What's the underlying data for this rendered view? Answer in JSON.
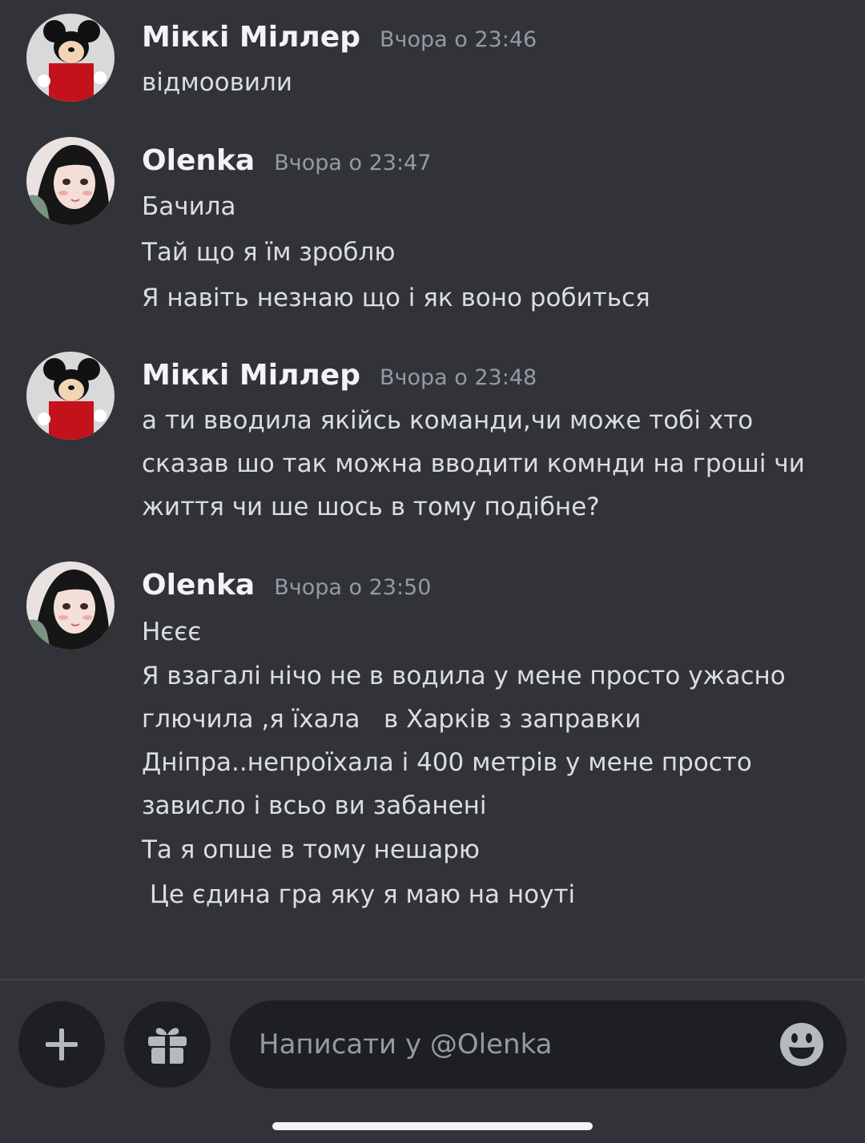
{
  "messages": [
    {
      "author": "Міккі Міллер",
      "timestamp": "Вчора о 23:46",
      "avatar_icon": "mickey-mouse-avatar",
      "lines": [
        "відмоовили"
      ]
    },
    {
      "author": "Olenka",
      "timestamp": "Вчора о 23:47",
      "avatar_icon": "anime-girl-avatar",
      "lines": [
        "Бачила",
        "Тай що я їм зроблю",
        "Я навіть незнаю що і як воно робиться"
      ]
    },
    {
      "author": "Міккі Міллер",
      "timestamp": "Вчора о 23:48",
      "avatar_icon": "mickey-mouse-avatar",
      "lines": [
        "а ти вводила якійсь команди,чи може тобі хто",
        "сказав шо так можна вводити комнди на гроші чи",
        "життя чи ше шось в тому подібне?"
      ]
    },
    {
      "author": "Olenka",
      "timestamp": "Вчора о 23:50",
      "avatar_icon": "anime-girl-avatar",
      "lines": [
        "Нєєє",
        "Я взагалі нічо не в водила у мене просто ужасно",
        "глючила ,я їхала   в Харків з заправки",
        "Дніпра..непроїхала і 400 метрів у мене просто",
        "зависло і всьо ви забанені",
        "Та я опше в тому нешарю",
        " Це єдина гра яку я маю на ноуті"
      ]
    }
  ],
  "composer": {
    "placeholder": "Написати у @Olenka",
    "add_icon": "plus-icon",
    "gift_icon": "gift-icon",
    "emoji_icon": "emoji-icon"
  },
  "colors": {
    "background": "#313338",
    "input_background": "#1e1f22",
    "username": "#f2f3f5",
    "timestamp": "#949ba4",
    "message_text": "#dbdee1"
  }
}
